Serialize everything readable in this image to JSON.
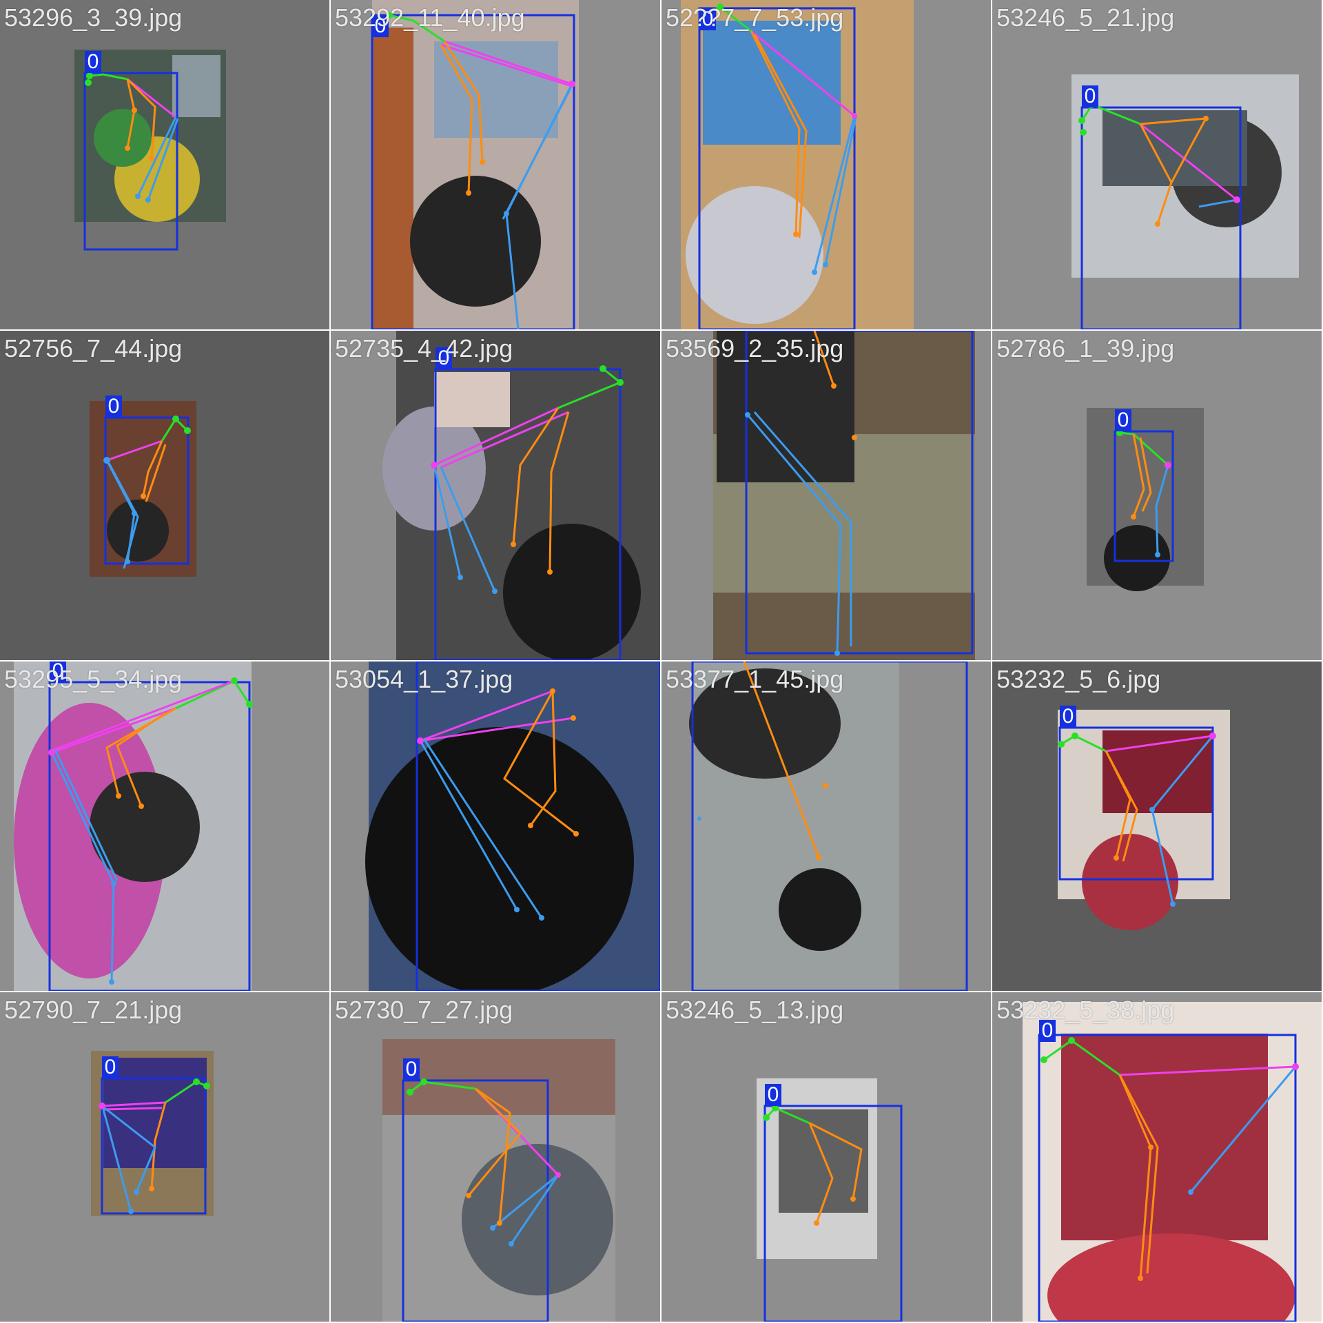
{
  "colors": {
    "box": "#1530e0",
    "face": "#28e028",
    "arm": "#ff8c10",
    "leg": "#3c9cf0",
    "torso": "#f040f0",
    "label_text": "#e8e8e8"
  },
  "class_label": "0",
  "tiles": [
    {
      "file": "53296_3_39.jpg"
    },
    {
      "file": "53292_11_40.jpg"
    },
    {
      "file": "52??7_7_53.jpg"
    },
    {
      "file": "53246_5_21.jpg"
    },
    {
      "file": "52756_7_44.jpg"
    },
    {
      "file": "52735_4_42.jpg"
    },
    {
      "file": "53569_2_35.jpg"
    },
    {
      "file": "52786_1_39.jpg"
    },
    {
      "file": "53295_5_34.jpg"
    },
    {
      "file": "53054_1_37.jpg"
    },
    {
      "file": "53377_1_45.jpg"
    },
    {
      "file": "53232_5_6.jpg"
    },
    {
      "file": "52790_7_21.jpg"
    },
    {
      "file": "52730_7_27.jpg"
    },
    {
      "file": "53246_5_13.jpg"
    },
    {
      "file": "53232_5_38.jpg"
    }
  ]
}
